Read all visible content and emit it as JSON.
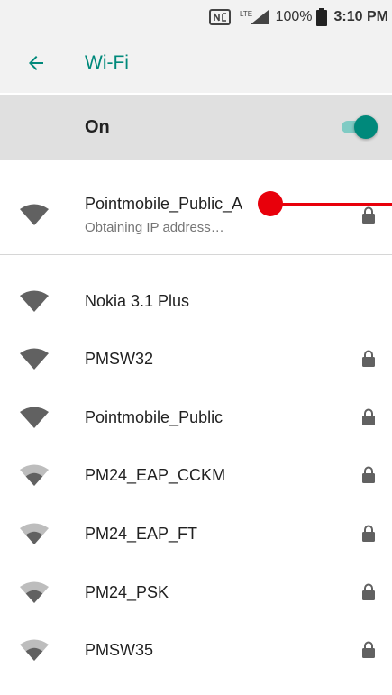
{
  "status_bar": {
    "nfc_icon": "nfc-icon",
    "lte_label": "LTE",
    "battery_percent": "100%",
    "time": "3:10 PM"
  },
  "app_bar": {
    "back_icon": "arrow-back-icon",
    "title": "Wi-Fi"
  },
  "toggle": {
    "label": "On",
    "enabled": true
  },
  "networks": [
    {
      "name": "Pointmobile_Public_A",
      "status": "Obtaining IP address…",
      "signal": "full",
      "secured": true
    },
    {
      "name": "Nokia 3.1 Plus",
      "status": "",
      "signal": "full",
      "secured": false
    },
    {
      "name": "PMSW32",
      "status": "",
      "signal": "full",
      "secured": true
    },
    {
      "name": "Pointmobile_Public",
      "status": "",
      "signal": "full",
      "secured": true
    },
    {
      "name": "PM24_EAP_CCKM",
      "status": "",
      "signal": "medium",
      "secured": true
    },
    {
      "name": "PM24_EAP_FT",
      "status": "",
      "signal": "medium",
      "secured": true
    },
    {
      "name": "PM24_PSK",
      "status": "",
      "signal": "medium",
      "secured": true
    },
    {
      "name": "PMSW35",
      "status": "",
      "signal": "medium",
      "secured": true
    }
  ],
  "colors": {
    "accent": "#00897b",
    "accent_light": "#80cbc4",
    "annotation": "#e8000b",
    "icon_dark": "#616161",
    "icon_light": "#bdbdbd"
  }
}
